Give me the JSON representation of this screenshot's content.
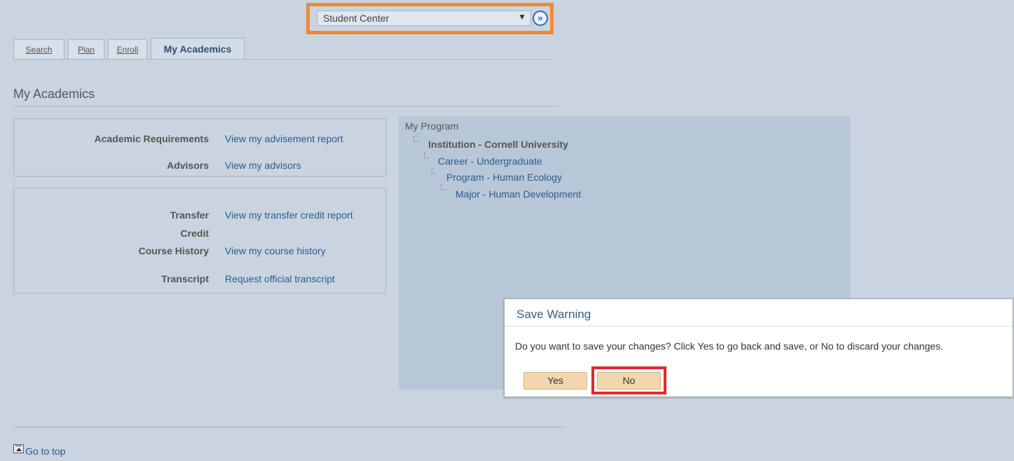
{
  "nav": {
    "selected": "Student Center"
  },
  "tabs": [
    {
      "label": "Search"
    },
    {
      "label": "Plan"
    },
    {
      "label": "Enroll"
    },
    {
      "label": "My Academics"
    }
  ],
  "page_title": "My Academics",
  "requirements_box": {
    "rows": [
      {
        "label": "Academic Requirements",
        "link": "View my advisement report"
      },
      {
        "label": "Advisors",
        "link": "View my advisors"
      }
    ]
  },
  "records_box": {
    "rows": [
      {
        "label_line1": "Transfer",
        "label_line2": "Credit",
        "link": "View my transfer credit report"
      },
      {
        "label": "Course History",
        "link": "View my course history"
      },
      {
        "label": "Transcript",
        "link": "Request official transcript"
      }
    ]
  },
  "program": {
    "heading": "My Program",
    "institution": "Institution - Cornell University",
    "career": "Career - Undergraduate",
    "program": "Program - Human Ecology",
    "major": "Major - Human Development"
  },
  "footer": {
    "go_to_top": "Go to top"
  },
  "dialog": {
    "title": "Save Warning",
    "message": "Do you want to save your changes? Click Yes to go back and save, or No to discard your changes.",
    "yes_label": "Yes",
    "no_label": "No"
  },
  "colors": {
    "background": "#c9d4e0",
    "highlight_orange": "#f08a30",
    "highlight_red": "#e4262e",
    "link": "#2d5c8c",
    "button": "#f4d6ac"
  }
}
